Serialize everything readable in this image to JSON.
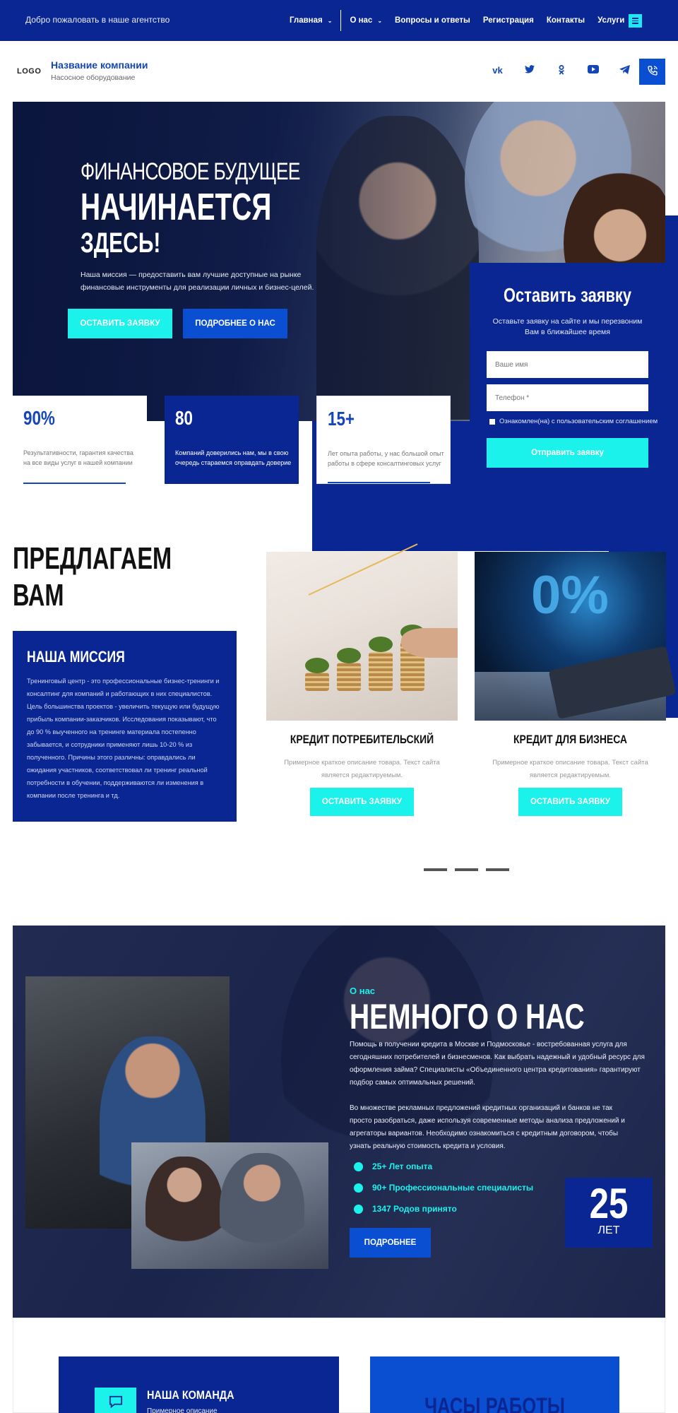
{
  "topbar": {
    "welcome": "Добро пожаловать в наше агентство",
    "nav": [
      {
        "label": "Главная",
        "dropdown": true
      },
      {
        "label": "О нас",
        "dropdown": true
      },
      {
        "label": "Вопросы и ответы",
        "dropdown": false
      },
      {
        "label": "Регистрация",
        "dropdown": false
      },
      {
        "label": "Контакты",
        "dropdown": false
      },
      {
        "label": "Услуги",
        "dropdown": true
      }
    ]
  },
  "header": {
    "logo": "LOGO",
    "company_name": "Название компании",
    "company_sub": "Насосное оборудование",
    "socials": [
      "vk-icon",
      "twitter-icon",
      "odnoklassniki-icon",
      "youtube-icon",
      "telegram-icon"
    ],
    "social_glyphs": [
      "vk",
      "🐦",
      "ok",
      "▶",
      "✈"
    ]
  },
  "hero": {
    "line1": "ФИНАНСОВОЕ БУДУЩЕЕ",
    "line2": "НАЧИНАЕТСЯ",
    "line3": "ЗДЕСЬ!",
    "description": "Наша миссия — предоставить вам лучшие доступные на рынке финансовые инструменты для реализации личных и бизнес-целей.",
    "btn_primary": "ОСТАВИТЬ ЗАЯВКУ",
    "btn_secondary": "ПОДРОБНЕЕ О НАС"
  },
  "form": {
    "title": "Оставить заявку",
    "subtitle": "Оставьте заявку на сайте и мы перезвоним Вам в ближайшее время",
    "name_placeholder": "Ваше имя",
    "phone_placeholder": "Телефон *",
    "agree": "Ознакомлен(на) с пользовательским соглашением",
    "submit": "Отправить заявку"
  },
  "stats": [
    {
      "value": "90%",
      "text": "Результативности, гарантия качества на все виды услуг в нашей компании"
    },
    {
      "value": "80",
      "text": "Компаний доверились нам, мы в свою очередь стараемся оправдать доверие"
    },
    {
      "value": "15+",
      "text": "Лет опыта работы, у нас большой опыт работы в сфере консалтинговых услуг"
    }
  ],
  "offer": {
    "title_line1": "ПРЕДЛАГАЕМ",
    "title_line2": "ВАМ",
    "mission_title": "НАША МИССИЯ",
    "mission_text": "Тренинговый центр - это профессиональные бизнес-тренинги и консалтинг для компаний и работающих в них специалистов. Цель большинства проектов - увеличить текущую или будущую прибыль компании-заказчиков. Исследования показывают, что до 90 % выученного на тренинге материала постепенно забывается, и сотрудники применяют лишь 10-20 % из полученного. Причины этого различны: оправдались ли ожидания участников, соответствовал ли тренинг реальной потребности в обучении, поддерживаются ли изменения в компании после тренинга и тд.",
    "cards": [
      {
        "title": "КРЕДИТ ПОТРЕБИТЕЛЬСКИЙ",
        "desc": "Примерное краткое описание товара. Текст сайта является редактируемым.",
        "button": "ОСТАВИТЬ ЗАЯВКУ"
      },
      {
        "title": "КРЕДИТ ДЛЯ БИЗНЕСА",
        "desc": "Примерное краткое описание товара. Текст сайта является редактируемым.",
        "button": "ОСТАВИТЬ ЗАЯВКУ"
      }
    ],
    "card2_zero": "0%"
  },
  "about": {
    "kicker": "О нас",
    "title": "НЕМНОГО О НАС",
    "p1": "Помощь в получении кредита в Москве и Подмосковье - востребованная услуга для сегодняшних потребителей и бизнесменов. Как выбрать надежный и удобный ресурс для оформления займа? Специалисты «Объединенного центра кредитования» гарантируют подбор самых оптимальных решений.",
    "p2": "Во множестве рекламных предложений кредитных организаций и банков не так просто разобраться, даже используя современные методы анализа предложений и агрегаторы вариантов. Необходимо ознакомиться с кредитным договором, чтобы узнать реальную стоимость кредита и условия.",
    "list": [
      "25+ Лет опыта",
      "90+ Профессиональные специалисты",
      "1347 Родов принято"
    ],
    "button": "ПОДРОБНЕЕ",
    "years_value": "25",
    "years_label": "ЛЕТ"
  },
  "bottom": {
    "team_title": "НАША КОМАНДА",
    "team_sub": "Примерное описание",
    "hours_title": "ЧАСЫ РАБОТЫ"
  },
  "colors": {
    "primary_dark": "#0a2693",
    "primary": "#0a4fd1",
    "accent_cyan": "#1cf2ec"
  }
}
